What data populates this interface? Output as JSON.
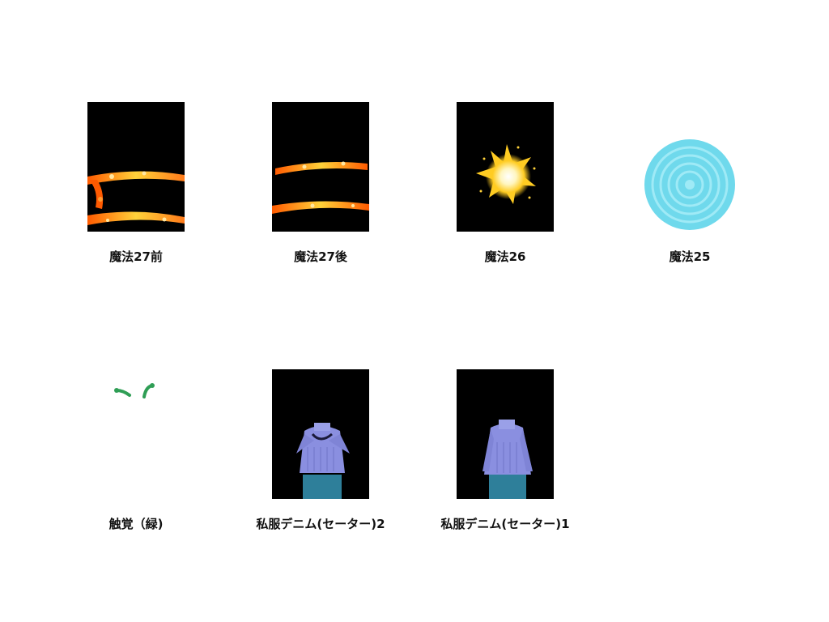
{
  "assets": [
    {
      "label": "魔法27前",
      "icon": "fire-rings-effect-icon",
      "background": "#000000"
    },
    {
      "label": "魔法27後",
      "icon": "fire-bands-effect-icon",
      "background": "#000000"
    },
    {
      "label": "魔法26",
      "icon": "light-burst-effect-icon",
      "background": "#000000"
    },
    {
      "label": "魔法25",
      "icon": "water-ripple-effect-icon",
      "background": "#ffffff"
    },
    {
      "label": "触覚（緑)",
      "icon": "green-antennae-icon",
      "background": "#ffffff"
    },
    {
      "label": "私服デニム(セーター)2",
      "icon": "sweater-denim-pose2-icon",
      "background": "#000000"
    },
    {
      "label": "私服デニム(セーター)1",
      "icon": "sweater-denim-pose1-icon",
      "background": "#000000"
    }
  ],
  "colors": {
    "fire_orange": "#ff7a1a",
    "fire_yellow": "#ffd23a",
    "burst_gold": "#ffcc22",
    "ripple_cyan": "#6fd9ec",
    "antenna_green": "#2f9e55",
    "sweater_lavender": "#8a8fe0",
    "denim_teal": "#2e7f9a"
  }
}
